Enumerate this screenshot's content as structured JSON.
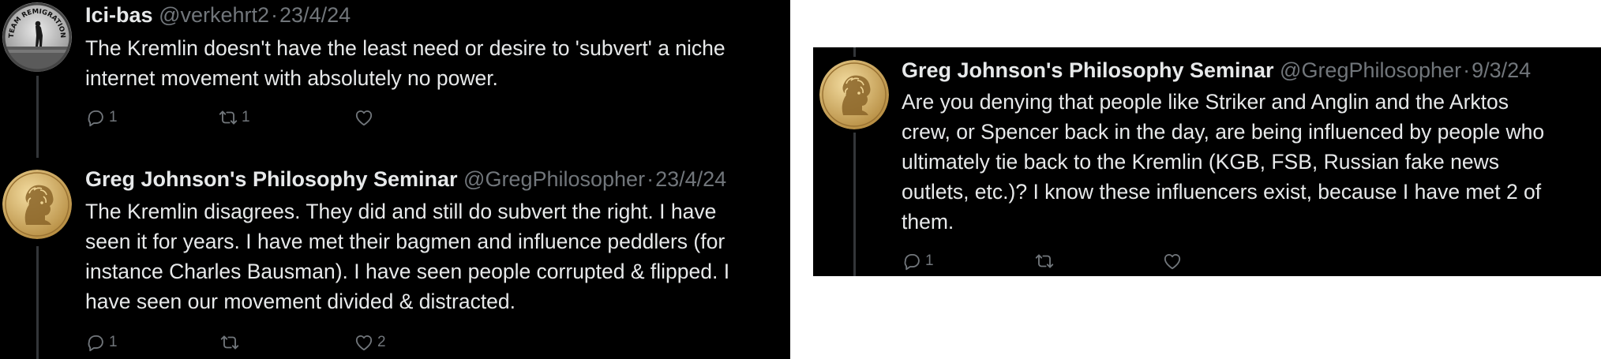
{
  "tweets": [
    {
      "name": "Ici-bas",
      "handle": "@verkehrt2",
      "separator": "·",
      "date": "23/4/24",
      "avatar_text": "TEAM REMIGRATION",
      "lines": [
        "The Kremlin doesn't have the least need or desire to 'subvert' a niche",
        "internet movement with absolutely no power."
      ],
      "actions": {
        "reply_count": "1",
        "repost_count": "1",
        "like_count": ""
      }
    },
    {
      "name": "Greg Johnson's Philosophy Seminar",
      "handle": "@GregPhilosopher",
      "separator": "·",
      "date": "23/4/24",
      "lines": [
        "The Kremlin disagrees. They did and still do subvert the right. I have",
        "seen it for years. I have met their bagmen and influence peddlers (for",
        "instance Charles Bausman). I have seen people corrupted & flipped. I",
        "have seen our movement divided & distracted."
      ],
      "actions": {
        "reply_count": "1",
        "repost_count": "",
        "like_count": "2"
      }
    },
    {
      "name": "Greg Johnson's Philosophy Seminar",
      "handle": "@GregPhilosopher",
      "separator": "·",
      "date": "9/3/24",
      "lines": [
        "Are you denying that people like Striker and Anglin and the Arktos",
        "crew, or Spencer back in the day, are being influenced by people who",
        "ultimately tie back to the Kremlin (KGB, FSB, Russian fake news",
        "outlets, etc.)? I know these influencers exist, because I have met 2 of",
        "them."
      ],
      "actions": {
        "reply_count": "1",
        "repost_count": "",
        "like_count": ""
      }
    }
  ],
  "colors": {
    "background": "#000000",
    "text": "#e7e9ea",
    "muted": "#71767b",
    "thread_line": "#333639",
    "medallion": "#c9a35c"
  },
  "icons": [
    "reply-icon",
    "repost-icon",
    "like-icon"
  ]
}
